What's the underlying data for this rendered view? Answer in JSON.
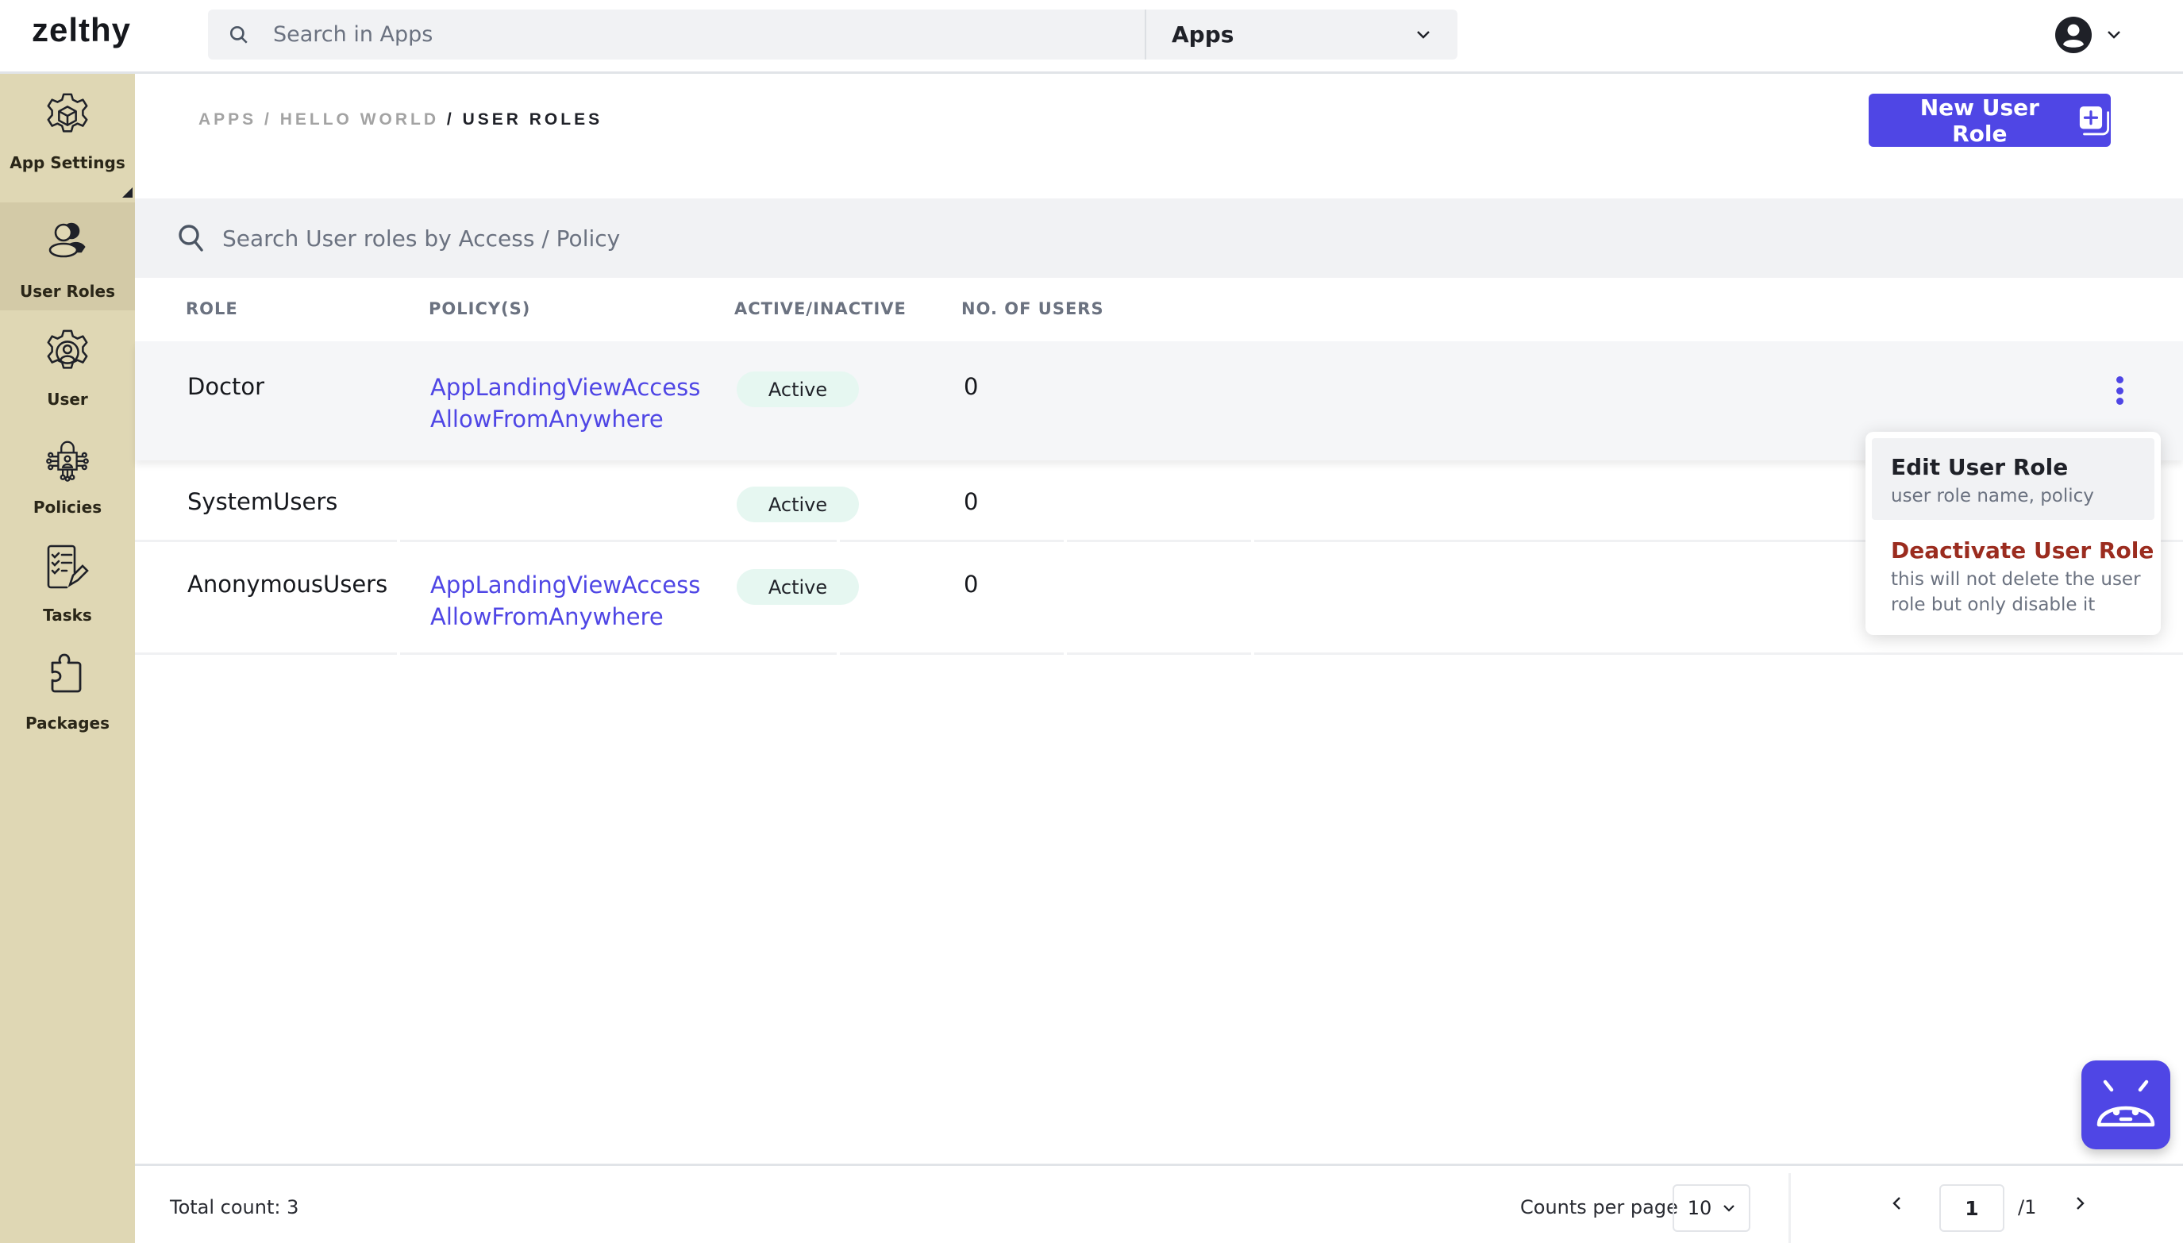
{
  "app": {
    "logo": "zelthy",
    "search_placeholder": "Search in Apps",
    "apps_select_value": "Apps"
  },
  "sidebar": {
    "items": [
      {
        "label": "App Settings",
        "icon": "gear-box-icon",
        "active": false
      },
      {
        "label": "User Roles",
        "icon": "user-roles-icon",
        "active": true
      },
      {
        "label": "User",
        "icon": "gear-user-icon",
        "active": false
      },
      {
        "label": "Policies",
        "icon": "lock-circuit-icon",
        "active": false
      },
      {
        "label": "Tasks",
        "icon": "checklist-pencil-icon",
        "active": false
      },
      {
        "label": "Packages",
        "icon": "puzzle-icon",
        "active": false
      }
    ]
  },
  "breadcrumb": {
    "items": [
      "APPS",
      "HELLO WORLD",
      "USER ROLES"
    ],
    "separator": "/"
  },
  "toolbar": {
    "new_label": "New User Role"
  },
  "table": {
    "search_placeholder": "Search User roles by Access / Policy",
    "columns": [
      "ROLE",
      "POLICY(S)",
      "ACTIVE/INACTIVE",
      "NO. OF USERS"
    ],
    "rows": [
      {
        "role": "Doctor",
        "policies": [
          "AppLandingViewAccess",
          "AllowFromAnywhere"
        ],
        "status": "Active",
        "users": "0"
      },
      {
        "role": "SystemUsers",
        "policies": [],
        "status": "Active",
        "users": "0"
      },
      {
        "role": "AnonymousUsers",
        "policies": [
          "AppLandingViewAccess",
          "AllowFromAnywhere"
        ],
        "status": "Active",
        "users": "0"
      }
    ]
  },
  "row_menu": {
    "items": [
      {
        "title": "Edit User Role",
        "subtitle": "user role name, policy"
      },
      {
        "title": "Deactivate User Role",
        "subtitle": "this will not delete the user role but only disable it"
      }
    ]
  },
  "footer": {
    "total_label": "Total count: 3",
    "counts_per_page_label": "Counts per page",
    "counts_per_page_value": "10",
    "current_page": "1",
    "total_pages_label": "/1"
  },
  "colors": {
    "accent": "#4f46e5",
    "danger": "#9b2c1f",
    "sidebar_bg": "#dfd7b4",
    "status_active_bg": "#e6f7f1"
  }
}
